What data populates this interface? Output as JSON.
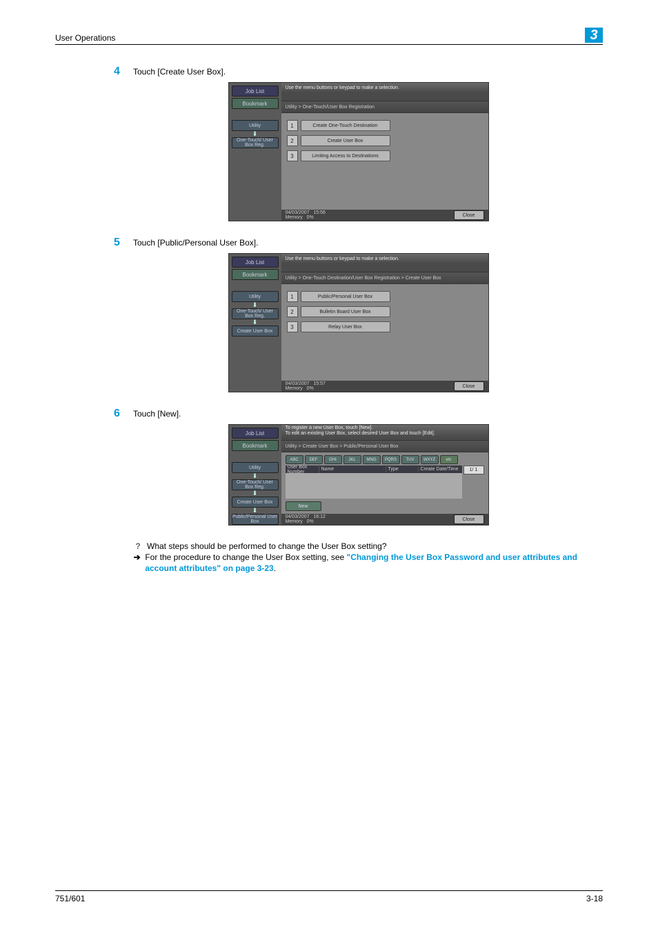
{
  "header": {
    "title": "User Operations",
    "chapter": "3"
  },
  "steps": [
    {
      "num": "4",
      "text": "Touch [Create User Box]."
    },
    {
      "num": "5",
      "text": "Touch [Public/Personal User Box]."
    },
    {
      "num": "6",
      "text": "Touch [New]."
    }
  ],
  "screen1": {
    "sidebar": {
      "joblist": "Job List",
      "bookmark": "Bookmark",
      "chain": [
        "Utility",
        "One-Touch/\nUser Box Reg."
      ]
    },
    "instruction": "Use the menu buttons or keypad to make a selection.",
    "path": "Utility > One-Touch/User Box Registration",
    "items": [
      {
        "n": "1",
        "label": "Create One-Touch\nDestination"
      },
      {
        "n": "2",
        "label": "Create User Box"
      },
      {
        "n": "3",
        "label": "Limiting Access\nto Destinations"
      }
    ],
    "status": {
      "date": "04/03/2007",
      "time": "15:56",
      "memlabel": "Memory",
      "memvalue": "0%"
    },
    "close": "Close"
  },
  "screen2": {
    "sidebar": {
      "joblist": "Job List",
      "bookmark": "Bookmark",
      "chain": [
        "Utility",
        "One-Touch/\nUser Box Reg.",
        "Create User Box"
      ]
    },
    "instruction": "Use the menu buttons or keypad to make a selection.",
    "path": "Utility > One-Touch Destination/User Box Registration > Create User Box",
    "items": [
      {
        "n": "1",
        "label": "Public/Personal User Box"
      },
      {
        "n": "2",
        "label": "Bulletin Board User Box"
      },
      {
        "n": "3",
        "label": "Relay User Box"
      }
    ],
    "status": {
      "date": "04/03/2007",
      "time": "15:57",
      "memlabel": "Memory",
      "memvalue": "0%"
    },
    "close": "Close"
  },
  "screen3": {
    "sidebar": {
      "joblist": "Job List",
      "bookmark": "Bookmark",
      "chain": [
        "Utility",
        "One-Touch/\nUser Box Reg.",
        "Create User Box",
        "Public/Personal\nUser Box"
      ]
    },
    "instruction1": "To register a new User Box, touch [New].",
    "instruction2": "To edit an existing User Box, select desired User Box and touch [Edit].",
    "path": "Utility > Create User Box > Public/Personal User Box",
    "filters": [
      "ABC",
      "DEF",
      "GHI",
      "JKL",
      "MNO",
      "PQRS",
      "TUV",
      "WXYZ",
      "etc"
    ],
    "columns": [
      "User Box\nNumber",
      "Name",
      "Type",
      "Create Date/Time"
    ],
    "pagecount": "1/  1",
    "newlabel": "New",
    "status": {
      "date": "04/03/2007",
      "time": "16:12",
      "memlabel": "Memory",
      "memvalue": "0%"
    },
    "close": "Close"
  },
  "qa": {
    "question": "What steps should be performed to change the User Box setting?",
    "answer_prefix": "For the procedure to change the User Box setting, see ",
    "link_text": "\"Changing the User Box Password and user attributes and account attributes\" on page 3-23",
    "answer_suffix": "."
  },
  "footer": {
    "left": "751/601",
    "right": "3-18"
  }
}
